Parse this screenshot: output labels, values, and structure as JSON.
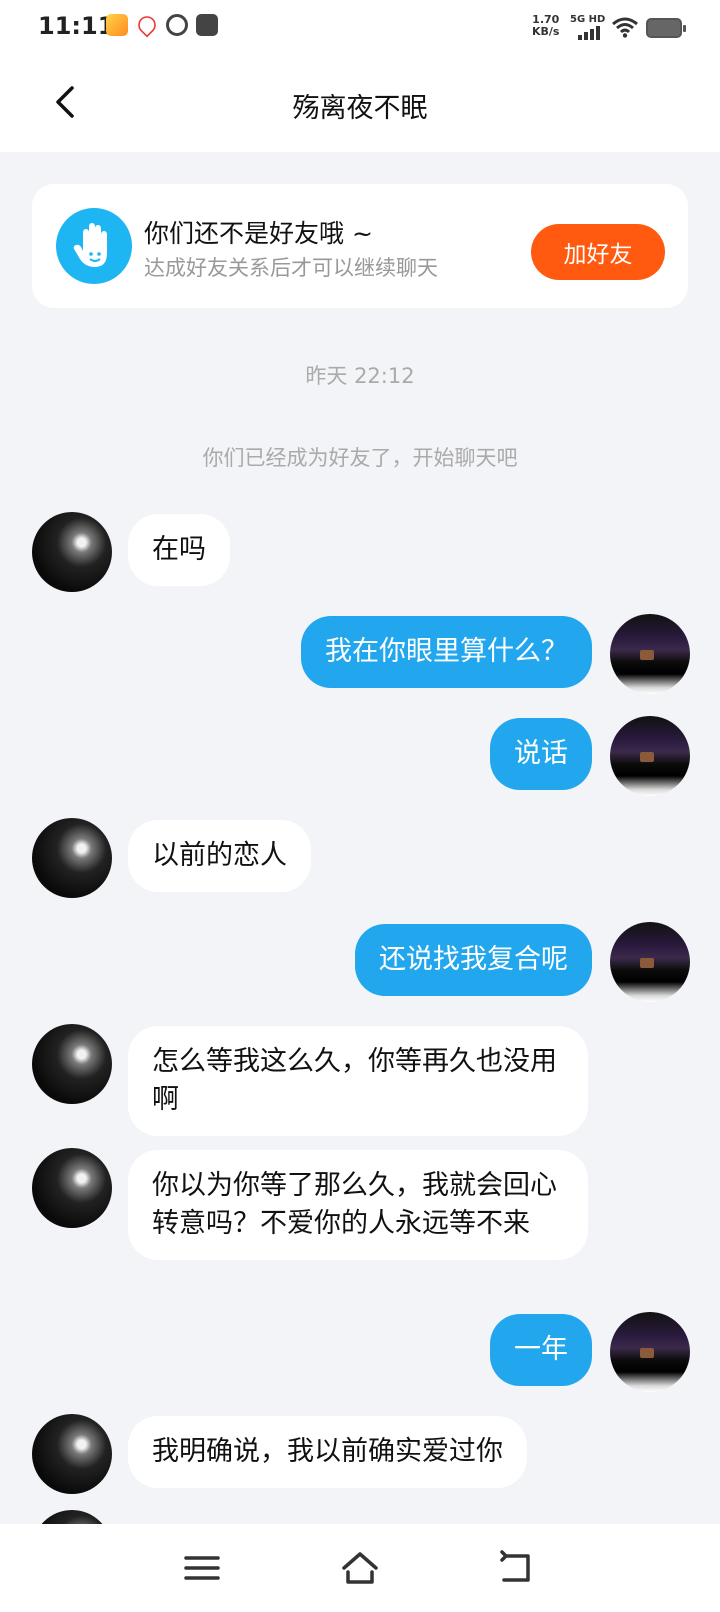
{
  "status_bar": {
    "time": "11:11",
    "speed_value": "1.70",
    "speed_unit": "KB/s",
    "network": "5G HD"
  },
  "header": {
    "title": "殇离夜不眠",
    "back_icon": "chevron-left-icon"
  },
  "friend_banner": {
    "title": "你们还不是好友哦 ~",
    "subtitle": "达成好友关系后才可以继续聊天",
    "button_label": "加好友",
    "icon": "hand-icon",
    "accent_color": "#ff5a0f"
  },
  "time_label": "昨天 22:12",
  "system_message": "你们已经成为好友了，开始聊天吧",
  "messages": [
    {
      "side": "in",
      "text": "在吗"
    },
    {
      "side": "out",
      "text": "我在你眼里算什么？"
    },
    {
      "side": "out",
      "text": "说话"
    },
    {
      "side": "in",
      "text": "以前的恋人"
    },
    {
      "side": "out",
      "text": "还说找我复合呢"
    },
    {
      "side": "in",
      "text": "怎么等我这么久，你等再久也没用啊"
    },
    {
      "side": "in",
      "text": "你以为你等了那么久，我就会回心转意吗？不爱你的人永远等不来"
    },
    {
      "side": "out",
      "text": "一年"
    },
    {
      "side": "in",
      "text": "我明确说，我以前确实爱过你"
    }
  ],
  "colors": {
    "outgoing_bubble": "#22a7ef",
    "incoming_bubble": "#ffffff",
    "background": "#f3f4f8"
  },
  "nav_bar": {
    "icons": [
      "menu-icon",
      "home-icon",
      "back-icon"
    ]
  }
}
